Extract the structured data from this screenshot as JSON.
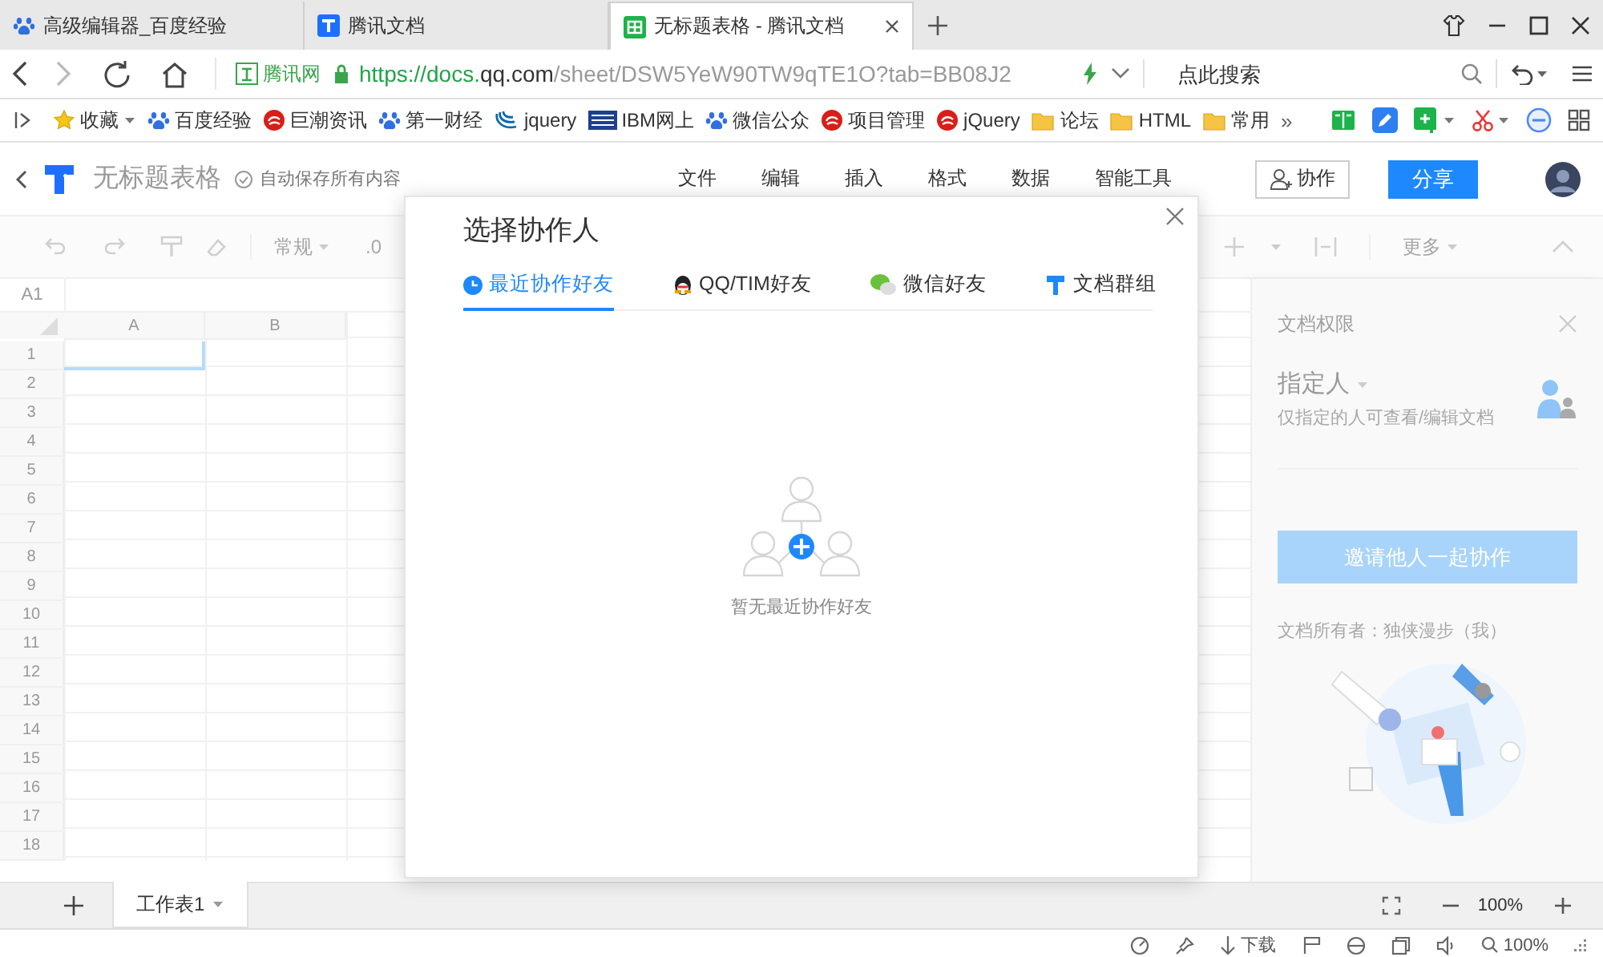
{
  "browser": {
    "tabs": [
      {
        "title": "高级编辑器_百度经验",
        "kind": "paw",
        "selected": false
      },
      {
        "title": "腾讯文档",
        "kind": "docs",
        "selected": false
      },
      {
        "title": "无标题表格 - 腾讯文档",
        "kind": "sheet",
        "selected": true
      }
    ],
    "site_label": "腾讯网",
    "url_prefix": "https://docs.",
    "url_domain": "qq.com",
    "url_suffix": "/sheet/DSW5YeW90TW9qTE1O?tab=BB08J2",
    "search_placeholder": "点此搜索",
    "bookmarks": [
      {
        "label": "收藏",
        "kind": "star",
        "menu": true
      },
      {
        "label": "百度经验",
        "kind": "paw",
        "menu": false
      },
      {
        "label": "巨潮资讯",
        "kind": "red",
        "menu": false
      },
      {
        "label": "第一财经",
        "kind": "paw",
        "menu": false
      },
      {
        "label": "jquery",
        "kind": "swirl",
        "menu": false
      },
      {
        "label": "IBM网上",
        "kind": "ibm",
        "menu": false
      },
      {
        "label": "微信公众",
        "kind": "paw",
        "menu": false
      },
      {
        "label": "项目管理",
        "kind": "red",
        "menu": false
      },
      {
        "label": "jQuery",
        "kind": "red",
        "menu": false
      },
      {
        "label": "论坛",
        "kind": "folder",
        "menu": false
      },
      {
        "label": "HTML",
        "kind": "folder",
        "menu": false
      },
      {
        "label": "常用",
        "kind": "folder",
        "menu": false
      }
    ],
    "more": "»"
  },
  "app": {
    "title": "无标题表格",
    "save_status": "自动保存所有内容",
    "menu": [
      "文件",
      "编辑",
      "插入",
      "格式",
      "数据",
      "智能工具"
    ],
    "collab_button": "协作",
    "share_button": "分享",
    "toolbar": {
      "number_format": "常规",
      "decimal": ".0",
      "more": "更多"
    },
    "sheet": {
      "cell_ref": "A1",
      "columns": [
        "A",
        "B"
      ],
      "rows": [
        "1",
        "2",
        "3",
        "4",
        "5",
        "6",
        "7",
        "8",
        "9",
        "10",
        "11",
        "12",
        "13",
        "14",
        "15",
        "16",
        "17",
        "18"
      ]
    },
    "panel": {
      "title": "文档权限",
      "mode": "指定人",
      "mode_hint": "仅指定的人可查看/编辑文档",
      "invite_button": "邀请他人一起协作",
      "owner": "文档所有者：独侠漫步（我）"
    },
    "sheet_tabs": [
      {
        "label": "工作表1",
        "selected": true
      }
    ],
    "zoom": "100%"
  },
  "dialog": {
    "title": "选择协作人",
    "tabs": [
      {
        "label": "最近协作好友",
        "kind": "clock",
        "selected": true
      },
      {
        "label": "QQ/TIM好友",
        "kind": "qq",
        "selected": false
      },
      {
        "label": "微信好友",
        "kind": "wechat",
        "selected": false
      },
      {
        "label": "文档群组",
        "kind": "group",
        "selected": false
      }
    ],
    "empty_text": "暂无最近协作好友"
  },
  "status_bar": {
    "download": "下载",
    "zoom": "100%"
  }
}
